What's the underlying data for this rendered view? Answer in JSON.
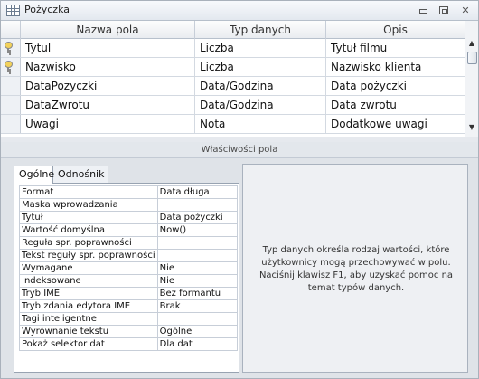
{
  "window": {
    "title": "Pożyczka",
    "icon": "table-icon",
    "controls": {
      "minimize": "minimize-icon",
      "maximize": "maximize-icon",
      "close_glyph": "✕"
    }
  },
  "grid": {
    "headers": [
      "Nazwa pola",
      "Typ danych",
      "Opis"
    ],
    "rows": [
      {
        "key": true,
        "name": "Tytul",
        "type": "Liczba",
        "desc": "Tytuł filmu"
      },
      {
        "key": true,
        "name": "Nazwisko",
        "type": "Liczba",
        "desc": "Nazwisko klienta"
      },
      {
        "key": false,
        "name": "DataPozyczki",
        "type": "Data/Godzina",
        "desc": "Data pożyczki",
        "editing": true
      },
      {
        "key": false,
        "name": "DataZwrotu",
        "type": "Data/Godzina",
        "desc": "Data zwrotu"
      },
      {
        "key": false,
        "name": "Uwagi",
        "type": "Nota",
        "desc": "Dodatkowe uwagi"
      }
    ]
  },
  "properties": {
    "section_title": "Właściwości pola",
    "tabs": [
      "Ogólne",
      "Odnośnik"
    ],
    "active_tab": "Ogólne",
    "rows": [
      {
        "name": "Format",
        "value": "Data długa"
      },
      {
        "name": "Maska wprowadzania",
        "value": ""
      },
      {
        "name": "Tytuł",
        "value": "Data pożyczki"
      },
      {
        "name": "Wartość domyślna",
        "value": "Now()"
      },
      {
        "name": "Reguła spr. poprawności",
        "value": ""
      },
      {
        "name": "Tekst reguły spr. poprawności",
        "value": ""
      },
      {
        "name": "Wymagane",
        "value": "Nie"
      },
      {
        "name": "Indeksowane",
        "value": "Nie"
      },
      {
        "name": "Tryb IME",
        "value": "Bez formantu"
      },
      {
        "name": "Tryb zdania edytora IME",
        "value": "Brak"
      },
      {
        "name": "Tagi inteligentne",
        "value": ""
      },
      {
        "name": "Wyrównanie tekstu",
        "value": "Ogólne"
      },
      {
        "name": "Pokaż selektor dat",
        "value": "Dla dat"
      }
    ],
    "help_text": "Typ danych określa rodzaj wartości, które użytkownicy mogą przechowywać w polu. Naciśnij klawisz F1, aby uzyskać pomoc na temat typów danych."
  }
}
